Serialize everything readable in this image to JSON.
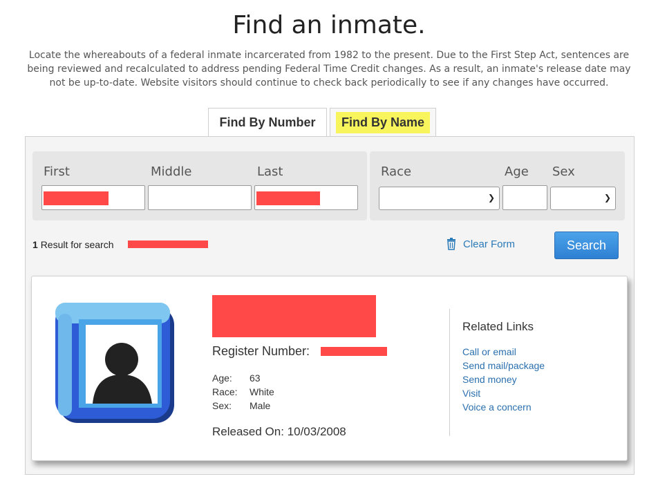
{
  "page": {
    "title": "Find an inmate.",
    "intro": "Locate the whereabouts of a federal inmate incarcerated from 1982 to the present. Due to the First Step Act, sentences are being reviewed and recalculated to address pending Federal Time Credit changes. As a result, an inmate's release date may not be up-to-date. Website visitors should continue to check back periodically to see if any changes have occurred."
  },
  "tabs": {
    "by_number": "Find By Number",
    "by_name": "Find By Name"
  },
  "form": {
    "first_label": "First",
    "middle_label": "Middle",
    "last_label": "Last",
    "race_label": "Race",
    "age_label": "Age",
    "sex_label": "Sex"
  },
  "results": {
    "count": "1",
    "count_text": "Result for search",
    "clear_label": "Clear Form",
    "search_label": "Search"
  },
  "inmate": {
    "register_label": "Register Number:",
    "age_label": "Age:",
    "age": "63",
    "race_label": "Race:",
    "race": "White",
    "sex_label": "Sex:",
    "sex": "Male",
    "released": "Released On: 10/03/2008"
  },
  "related": {
    "title": "Related Links",
    "links": [
      "Call or email",
      "Send mail/package",
      "Send money",
      "Visit",
      "Voice a concern"
    ]
  },
  "colors": {
    "accent": "#2d80d2",
    "highlight": "#f7f45c",
    "redaction": "#ff4848",
    "link": "#2a6fae"
  },
  "icons": {
    "clear": "trash-icon",
    "photo": "person-photo-icon"
  }
}
